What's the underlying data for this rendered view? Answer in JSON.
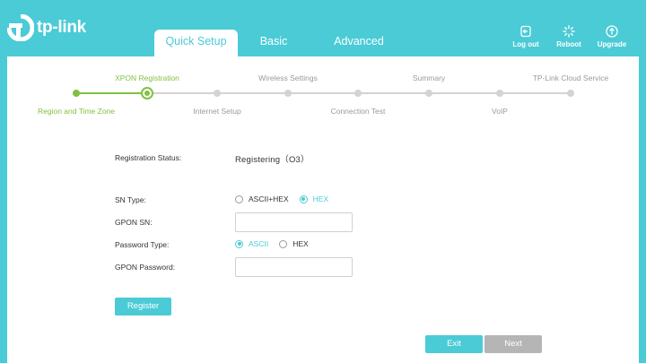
{
  "brand": {
    "name": "tp-link",
    "color": "#4acbd6",
    "accent_green": "#7fc241"
  },
  "tabs": [
    {
      "label": "Quick Setup",
      "active": true
    },
    {
      "label": "Basic",
      "active": false
    },
    {
      "label": "Advanced",
      "active": false
    }
  ],
  "header_actions": [
    {
      "label": "Log out",
      "icon": "logout-icon"
    },
    {
      "label": "Reboot",
      "icon": "reboot-icon"
    },
    {
      "label": "Upgrade",
      "icon": "upgrade-icon"
    }
  ],
  "wizard": {
    "steps": [
      {
        "label": "Region and Time Zone",
        "state": "done"
      },
      {
        "label": "XPON Registration",
        "state": "current"
      },
      {
        "label": "Internet Setup",
        "state": "pending"
      },
      {
        "label": "Wireless Settings",
        "state": "pending"
      },
      {
        "label": "Connection Test",
        "state": "pending"
      },
      {
        "label": "Summary",
        "state": "pending"
      },
      {
        "label": "VoIP",
        "state": "pending"
      },
      {
        "label": "TP-Link Cloud Service",
        "state": "pending"
      }
    ]
  },
  "form": {
    "registration_status_label": "Registration Status:",
    "registration_status_value": "Registering（O3）",
    "sn_type_label": "SN Type:",
    "sn_type_options": [
      {
        "label": "ASCII+HEX",
        "selected": false
      },
      {
        "label": "HEX",
        "selected": true
      }
    ],
    "gpon_sn_label": "GPON SN:",
    "gpon_sn_value": "",
    "password_type_label": "Password Type:",
    "password_type_options": [
      {
        "label": "ASCII",
        "selected": true
      },
      {
        "label": "HEX",
        "selected": false
      }
    ],
    "gpon_password_label": "GPON Password:",
    "gpon_password_value": ""
  },
  "buttons": {
    "register": "Register",
    "exit": "Exit",
    "next": "Next"
  }
}
